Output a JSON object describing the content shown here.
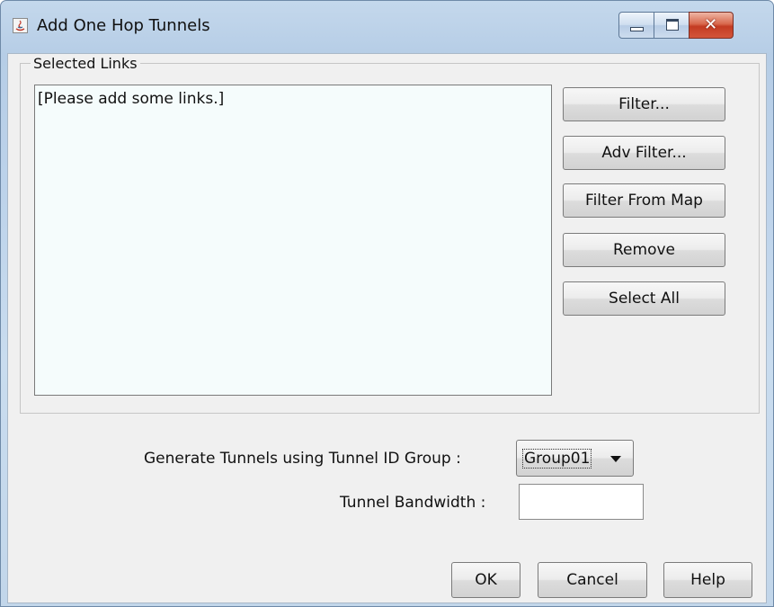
{
  "window": {
    "title": "Add One Hop Tunnels",
    "icons": [
      "java-app-icon",
      "minimize-icon",
      "maximize-icon",
      "close-icon"
    ],
    "close_glyph": "✕"
  },
  "selected_links": {
    "group_label": "Selected Links",
    "placeholder": "[Please add some links.]"
  },
  "side_buttons": {
    "filter": "Filter...",
    "adv_filter": "Adv Filter...",
    "filter_from_map": "Filter From Map",
    "remove": "Remove",
    "select_all": "Select All"
  },
  "form": {
    "tunnel_id_group_label": "Generate Tunnels using Tunnel ID Group :",
    "tunnel_id_group_value": "Group01",
    "tunnel_bandwidth_label": "Tunnel Bandwidth :",
    "tunnel_bandwidth_value": ""
  },
  "footer": {
    "ok": "OK",
    "cancel": "Cancel",
    "help": "Help"
  },
  "colors": {
    "title_bar": "#bcd2ea",
    "panel": "#f0f0f0",
    "list_background": "#f5fcfc",
    "close_button": "#c33b22"
  }
}
